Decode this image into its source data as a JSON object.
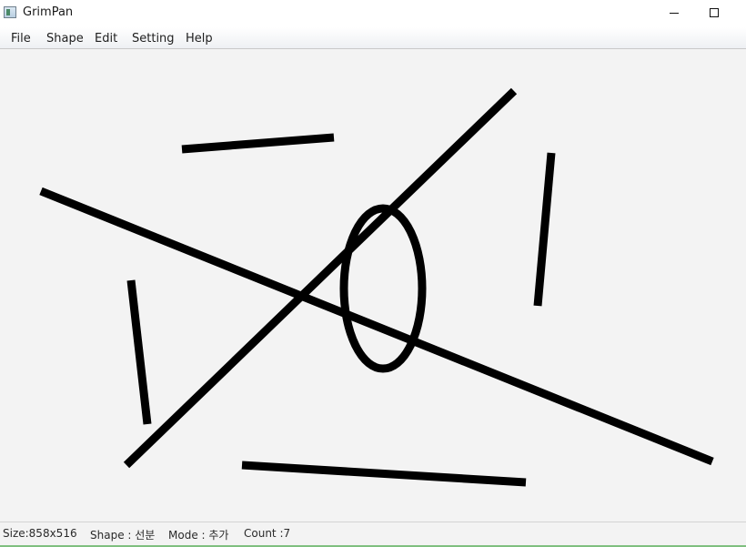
{
  "window": {
    "title": "GrimPan"
  },
  "menu": {
    "file": "File",
    "shape": "Shape",
    "edit": "Edit",
    "setting": "Setting",
    "help": "Help"
  },
  "status": {
    "size": "Size:858x516",
    "shape": "Shape : 선분",
    "mode": "Mode : 추가",
    "count": "Count :7"
  },
  "colors": {
    "canvas_background": "#f3f3f3",
    "stroke": "#000000",
    "status_accent": "#7fbf7f"
  }
}
